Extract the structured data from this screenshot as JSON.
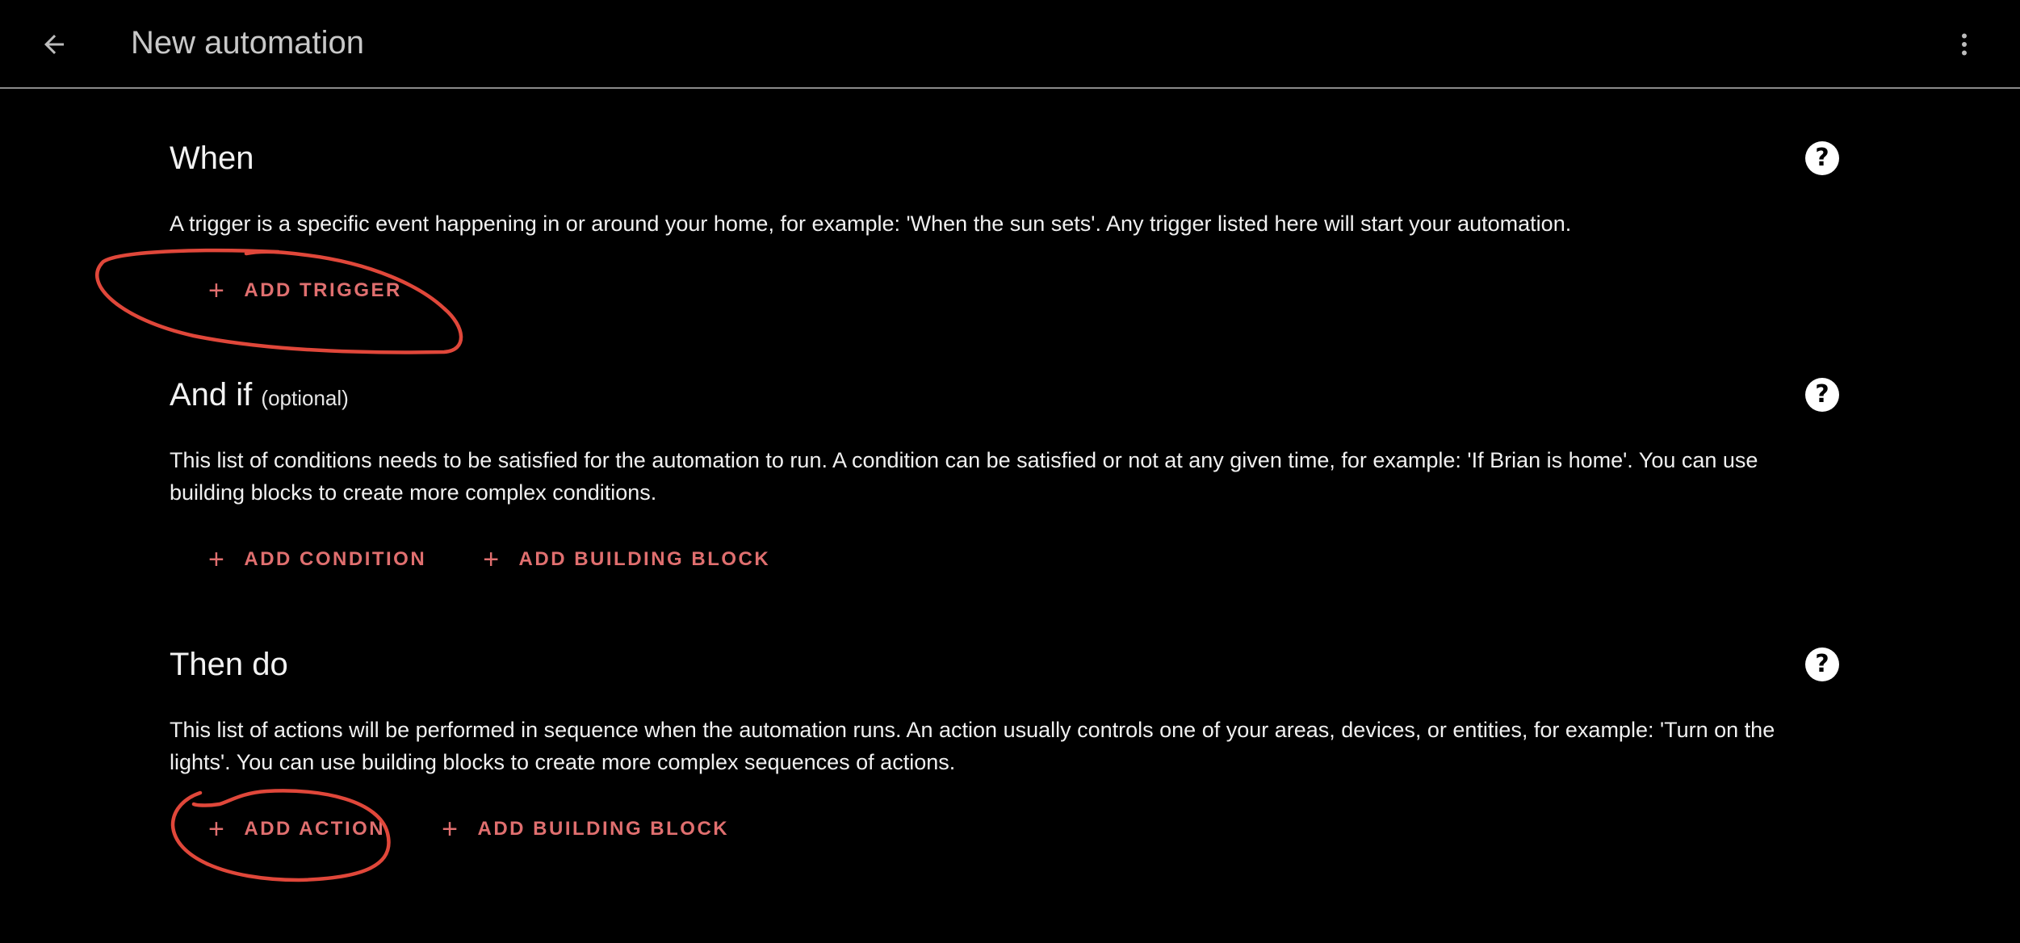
{
  "header": {
    "title": "New automation",
    "back_icon": "arrow-left-icon",
    "menu_icon": "dots-vertical-icon"
  },
  "sections": {
    "when": {
      "heading": "When",
      "description": "A trigger is a specific event happening in or around your home, for example: 'When the sun sets'. Any trigger listed here will start your automation.",
      "buttons": [
        "ADD TRIGGER"
      ],
      "help_icon": "?"
    },
    "and_if": {
      "heading": "And if",
      "optional": "(optional)",
      "description": "This list of conditions needs to be satisfied for the automation to run. A condition can be satisfied or not at any given time, for example: 'If Brian is home'. You can use building blocks to create more complex conditions.",
      "buttons": [
        "ADD CONDITION",
        "ADD BUILDING BLOCK"
      ],
      "help_icon": "?"
    },
    "then_do": {
      "heading": "Then do",
      "description": "This list of actions will be performed in sequence when the automation runs. An action usually controls one of your areas, devices, or entities, for example: 'Turn on the lights'. You can use building blocks to create more complex sequences of actions.",
      "buttons": [
        "ADD ACTION",
        "ADD BUILDING BLOCK"
      ],
      "help_icon": "?"
    }
  },
  "button_plus": "+",
  "colors": {
    "background": "#000000",
    "accent": "#e06f6f",
    "annotation": "#e0473a",
    "divider": "#8a8a8a"
  }
}
